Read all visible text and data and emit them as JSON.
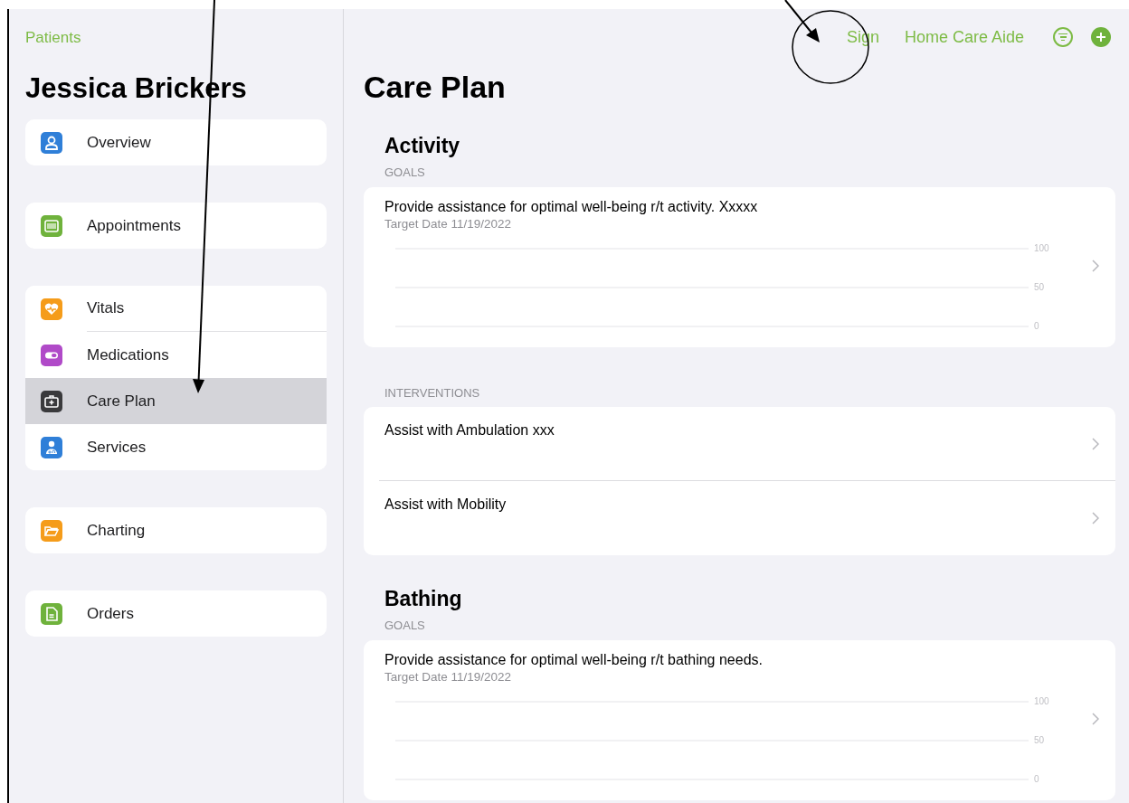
{
  "sidebar": {
    "back": "Patients",
    "title": "Jessica Brickers",
    "groups": [
      [
        {
          "label": "Overview",
          "color": "#2f7fd8",
          "selected": false
        }
      ],
      [
        {
          "label": "Appointments",
          "color": "#6fb23c",
          "selected": false
        }
      ],
      [
        {
          "label": "Vitals",
          "color": "#f59c1a",
          "selected": false
        },
        {
          "label": "Medications",
          "color": "#b04ac8",
          "selected": false
        },
        {
          "label": "Care Plan",
          "color": "#3a3a3c",
          "selected": true
        },
        {
          "label": "Services",
          "color": "#2f7fd8",
          "selected": false
        }
      ],
      [
        {
          "label": "Charting",
          "color": "#f59c1a",
          "selected": false
        }
      ],
      [
        {
          "label": "Orders",
          "color": "#6fb23c",
          "selected": false
        }
      ]
    ]
  },
  "toolbar": {
    "actions": [
      {
        "kind": "text",
        "label": "Sign"
      },
      {
        "kind": "text",
        "label": "Home Care Aide"
      },
      {
        "kind": "filter"
      },
      {
        "kind": "add"
      }
    ]
  },
  "main": {
    "title": "Care Plan",
    "sections": [
      {
        "title": "Activity",
        "groups": [
          {
            "kind": "goals",
            "header": "GOALS",
            "items": [
              {
                "text": "Provide assistance for optimal well-being r/t activity. Xxxxx",
                "target_date": "Target Date 11/19/2022",
                "scale_labels": [
                  "100",
                  "50",
                  "0"
                ]
              }
            ]
          },
          {
            "kind": "interventions",
            "header": "INTERVENTIONS",
            "items": [
              {
                "text": "Assist with Ambulation xxx"
              },
              {
                "text": "Assist with Mobility"
              }
            ]
          }
        ]
      },
      {
        "title": "Bathing",
        "groups": [
          {
            "kind": "goals",
            "header": "GOALS",
            "items": [
              {
                "text": "Provide assistance for optimal well-being r/t bathing needs.",
                "target_date": "Target Date 11/19/2022",
                "scale_labels": [
                  "100",
                  "50",
                  "0"
                ]
              }
            ]
          }
        ]
      }
    ]
  }
}
